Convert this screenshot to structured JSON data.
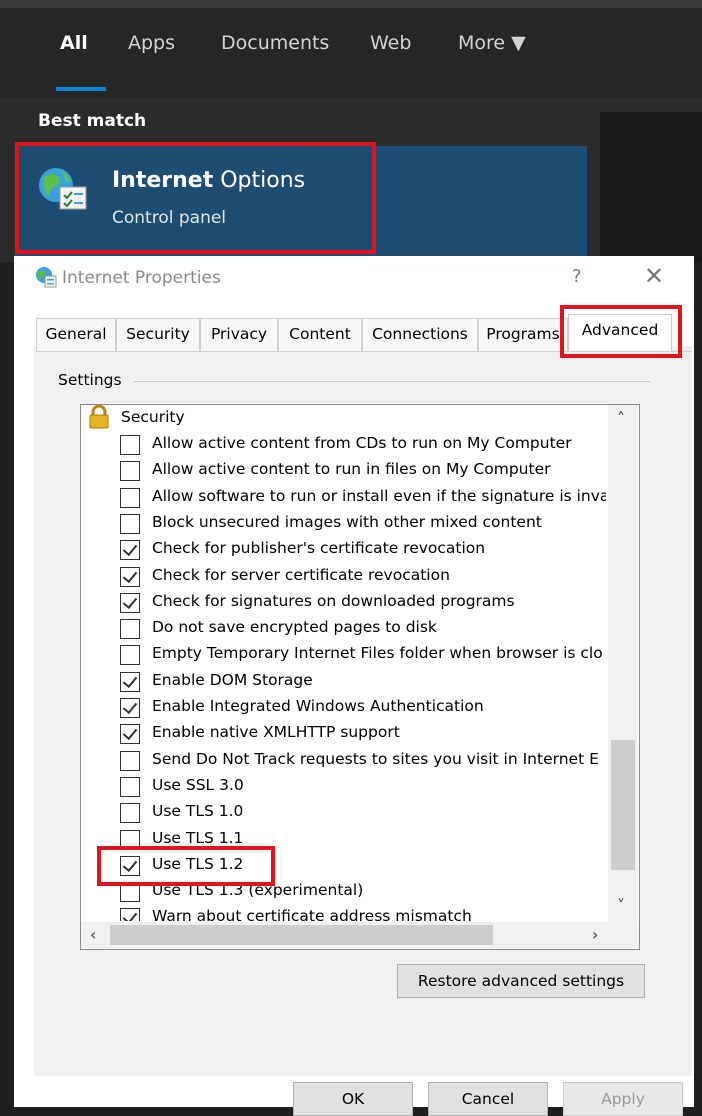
{
  "search": {
    "tabs": [
      {
        "label": "All",
        "active": true
      },
      {
        "label": "Apps"
      },
      {
        "label": "Documents"
      },
      {
        "label": "Web"
      },
      {
        "label": "More ▼"
      }
    ],
    "best_match_label": "Best match",
    "result": {
      "title_bold": "Internet",
      "title_rest": " Options",
      "subtitle": "Control panel",
      "icon": "internet-options-icon"
    }
  },
  "dialog": {
    "title": "Internet Properties",
    "help": "?",
    "close": "✕",
    "tabs": [
      "General",
      "Security",
      "Privacy",
      "Content",
      "Connections",
      "Programs",
      "Advanced"
    ],
    "active_tab": "Advanced",
    "settings_label": "Settings",
    "group": {
      "label": "Security",
      "icon": "lock-icon"
    },
    "items": [
      {
        "label": "Allow active content from CDs to run on My Computer",
        "checked": false
      },
      {
        "label": "Allow active content to run in files on My Computer",
        "checked": false
      },
      {
        "label": "Allow software to run or install even if the signature is inva",
        "checked": false
      },
      {
        "label": "Block unsecured images with other mixed content",
        "checked": false
      },
      {
        "label": "Check for publisher's certificate revocation",
        "checked": true
      },
      {
        "label": "Check for server certificate revocation",
        "checked": true
      },
      {
        "label": "Check for signatures on downloaded programs",
        "checked": true
      },
      {
        "label": "Do not save encrypted pages to disk",
        "checked": false
      },
      {
        "label": "Empty Temporary Internet Files folder when browser is clo",
        "checked": false
      },
      {
        "label": "Enable DOM Storage",
        "checked": true
      },
      {
        "label": "Enable Integrated Windows Authentication",
        "checked": true
      },
      {
        "label": "Enable native XMLHTTP support",
        "checked": true
      },
      {
        "label": "Send Do Not Track requests to sites you visit in Internet E",
        "checked": false
      },
      {
        "label": "Use SSL 3.0",
        "checked": false
      },
      {
        "label": "Use TLS 1.0",
        "checked": false
      },
      {
        "label": "Use TLS 1.1",
        "checked": false
      },
      {
        "label": "Use TLS 1.2",
        "checked": true
      },
      {
        "label": "Use TLS 1.3 (experimental)",
        "checked": false
      },
      {
        "label": "Warn about certificate address mismatch",
        "checked": true
      }
    ],
    "restore_label": "Restore advanced settings",
    "buttons": {
      "ok": "OK",
      "cancel": "Cancel",
      "apply": "Apply"
    }
  },
  "colors": {
    "highlight": "#e0141e",
    "search_accent": "#0a84d8",
    "result_bg": "#1d4d73"
  }
}
